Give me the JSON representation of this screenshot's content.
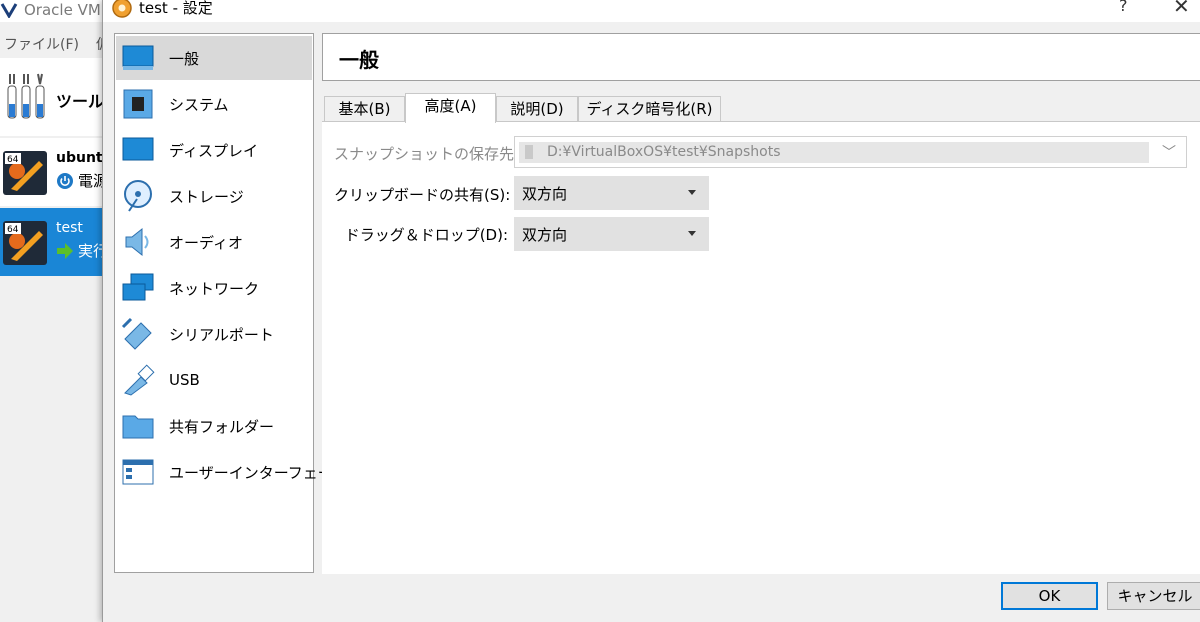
{
  "manager": {
    "title": "Oracle VM",
    "menu": [
      "ファイル(F)",
      "仮"
    ],
    "tools_label": "ツール",
    "vms": [
      {
        "name": "ubuntu",
        "state": "電源",
        "badge": "64"
      },
      {
        "name": "test",
        "state": "実行",
        "badge": "64"
      }
    ]
  },
  "dialog": {
    "title": "test - 設定",
    "help_glyph": "?",
    "close_glyph": "✕",
    "nav": [
      {
        "label": "一般",
        "icon": "general-icon"
      },
      {
        "label": "システム",
        "icon": "system-chip-icon"
      },
      {
        "label": "ディスプレイ",
        "icon": "display-monitor-icon"
      },
      {
        "label": "ストレージ",
        "icon": "storage-disk-icon"
      },
      {
        "label": "オーディオ",
        "icon": "audio-speaker-icon"
      },
      {
        "label": "ネットワーク",
        "icon": "network-icon"
      },
      {
        "label": "シリアルポート",
        "icon": "serial-port-icon"
      },
      {
        "label": "USB",
        "icon": "usb-icon"
      },
      {
        "label": "共有フォルダー",
        "icon": "shared-folder-icon"
      },
      {
        "label": "ユーザーインターフェース",
        "icon": "user-interface-icon"
      }
    ],
    "section_title": "一般",
    "tabs": [
      "基本(B)",
      "高度(A)",
      "説明(D)",
      "ディスク暗号化(R)"
    ],
    "active_tab": "高度(A)",
    "fields": {
      "snapshot_label": "スナップショットの保存先(N):",
      "snapshot_value": "D:¥VirtualBoxOS¥test¥Snapshots",
      "clipboard_label": "クリップボードの共有(S):",
      "clipboard_value": "双方向",
      "dragdrop_label": "ドラッグ＆ドロップ(D):",
      "dragdrop_value": "双方向"
    },
    "buttons": {
      "ok": "OK",
      "cancel": "キャンセル"
    }
  },
  "colors": {
    "selection": "#1a86d6",
    "nav_active": "#d9d9d9",
    "default_button_border": "#0078d7"
  }
}
